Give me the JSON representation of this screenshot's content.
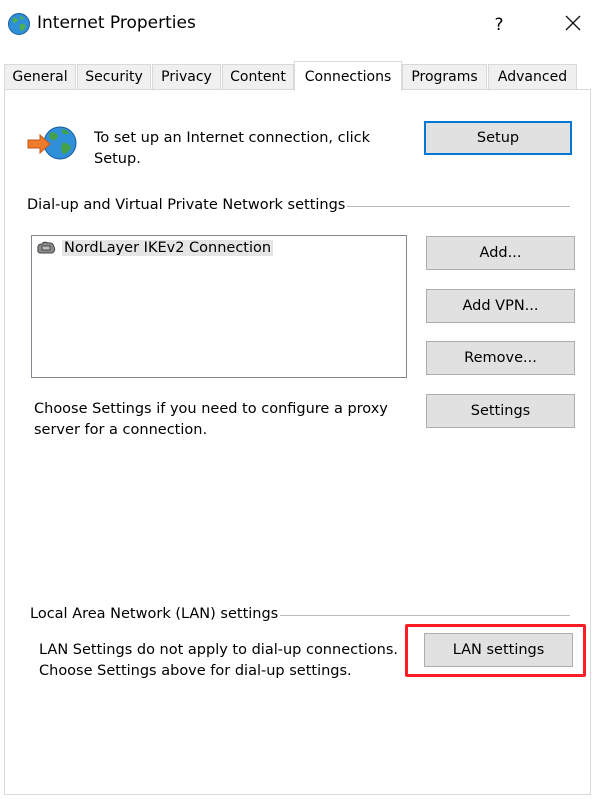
{
  "window": {
    "title": "Internet Properties",
    "help_label": "?"
  },
  "tabs": [
    {
      "label": "General",
      "active": false
    },
    {
      "label": "Security",
      "active": false
    },
    {
      "label": "Privacy",
      "active": false
    },
    {
      "label": "Content",
      "active": false
    },
    {
      "label": "Connections",
      "active": true
    },
    {
      "label": "Programs",
      "active": false
    },
    {
      "label": "Advanced",
      "active": false
    }
  ],
  "setup": {
    "description": "To set up an Internet connection, click Setup.",
    "button_label": "Setup"
  },
  "dialup": {
    "group_label": "Dial-up and Virtual Private Network settings",
    "connections": [
      "NordLayer IKEv2 Connection"
    ],
    "add_label": "Add...",
    "add_vpn_label": "Add VPN...",
    "remove_label": "Remove...",
    "proxy_description": "Choose Settings if you need to configure a proxy server for a connection.",
    "settings_label": "Settings"
  },
  "lan": {
    "group_label": "Local Area Network (LAN) settings",
    "description": "LAN Settings do not apply to dial-up connections. Choose Settings above for dial-up settings.",
    "button_label": "LAN settings"
  },
  "colors": {
    "accent": "#0078d7",
    "highlight": "#ff1d25"
  },
  "icons": {
    "title": "internet-globe-icon",
    "setup": "connection-wizard-icon",
    "connection": "dialup-connection-icon",
    "close": "close-icon"
  }
}
